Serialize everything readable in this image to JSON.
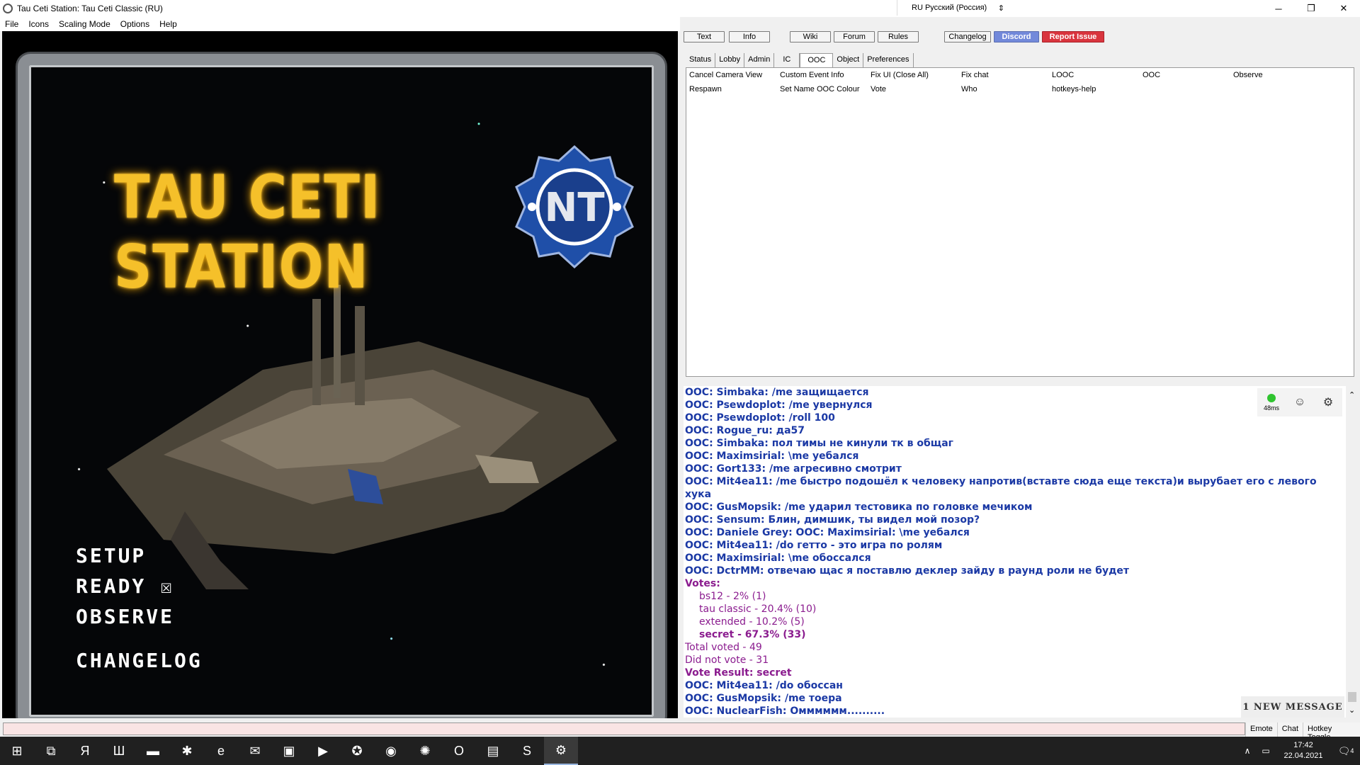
{
  "window": {
    "title": "Tau Ceti Station: Tau Ceti Classic (RU)",
    "language": "RU Русский (Россия)",
    "minimize": "─",
    "maximize": "❐",
    "close": "✕"
  },
  "menu": [
    "File",
    "Icons",
    "Scaling Mode",
    "Options",
    "Help"
  ],
  "game": {
    "title": "TAU CETI STATION",
    "logo_text": "NT",
    "lobby_items": [
      "SETUP",
      "READY ☒",
      "OBSERVE",
      "CHANGELOG"
    ]
  },
  "top_buttons": [
    "Text",
    "Info",
    "Wiki",
    "Forum",
    "Rules",
    "Changelog",
    "Discord",
    "Report Issue"
  ],
  "tabs": [
    "Status",
    "Lobby",
    "Admin",
    "IC",
    "OOC",
    "Object",
    "Preferences"
  ],
  "active_tab": "OOC",
  "verbs": [
    "Cancel Camera View",
    "Custom Event Info",
    "Fix UI (Close All)",
    "Fix chat",
    "LOOC",
    "OOC",
    "Observe",
    "Respawn",
    "Set Name OOC Colour",
    "Vote",
    "Who",
    "hotkeys-help"
  ],
  "chat_tools": {
    "ping": "48ms",
    "emoji_icon": "smiley-icon",
    "settings_icon": "gear-icon"
  },
  "chat_lines": [
    {
      "t": "OOC: Simbaka: /me защищается",
      "k": "ooc"
    },
    {
      "t": "OOC: Psewdoplot: /me увернулся",
      "k": "ooc"
    },
    {
      "t": "OOC: Psewdoplot: /roll 100",
      "k": "ooc"
    },
    {
      "t": "OOC: Rogue_ru: да57",
      "k": "ooc"
    },
    {
      "t": "OOC: Simbaka: пол тимы не кинули тк в общаг",
      "k": "ooc"
    },
    {
      "t": "OOC: Maximsirial: \\me уебался",
      "k": "ooc"
    },
    {
      "t": "OOC: Gort133: /me агресивно смотрит",
      "k": "ooc"
    },
    {
      "t": "OOC: Mit4ea11: /me быстро подошёл к человеку напротив(вставте сюда еще текста)и вырубает его с левого хука",
      "k": "ooc"
    },
    {
      "t": "OOC: GusMopsik: /me ударил тестовика по головке мечиком",
      "k": "ooc"
    },
    {
      "t": "OOC: Sensum: Блин, димшик, ты видел мой позор?",
      "k": "ooc"
    },
    {
      "t": "OOC: Daniele Grey: OOC: Maximsirial: \\me уебался",
      "k": "ooc"
    },
    {
      "t": "OOC: Mit4ea11: /do гетто - это игра по ролям",
      "k": "ooc"
    },
    {
      "t": "OOC: Maximsirial: \\me обоссался",
      "k": "ooc"
    },
    {
      "t": "OOC: DctrMM: отвечаю щас я поставлю деклер зайду в раунд роли не будет",
      "k": "ooc"
    },
    {
      "t": "Votes:",
      "k": "vote-b"
    },
    {
      "t": "bs12 - 2% (1)",
      "k": "vote-ind"
    },
    {
      "t": "tau classic - 20.4% (10)",
      "k": "vote-ind"
    },
    {
      "t": "extended - 10.2% (5)",
      "k": "vote-ind"
    },
    {
      "t": "secret - 67.3% (33)",
      "k": "vote-ind-b"
    },
    {
      "t": "Total voted - 49",
      "k": "vote"
    },
    {
      "t": "Did not vote - 31",
      "k": "vote"
    },
    {
      "t": "Vote Result: secret",
      "k": "vote-b"
    },
    {
      "t": "OOC: Mit4ea11: /do обоссан",
      "k": "ooc"
    },
    {
      "t": "OOC: GusMopsik: /me тоера",
      "k": "ooc"
    },
    {
      "t": "OOC: NuclearFish: Омммммм..........",
      "k": "ooc"
    }
  ],
  "new_message": "1 NEW MESSAGE",
  "bottom_buttons": [
    "Emote",
    "Chat",
    "Hotkey Toggle"
  ],
  "taskbar": {
    "icons": [
      "windows-start-icon",
      "task-view-icon",
      "yandex-browser-icon",
      "red-app-icon",
      "file-explorer-icon",
      "green-app-icon",
      "edge-icon",
      "mail-icon",
      "store-icon",
      "zoom-icon",
      "discord-like-icon",
      "steam-icon",
      "byond-icon",
      "opera-icon",
      "window-app-icon",
      "skype-icon",
      "dreamseeker-icon"
    ],
    "time": "17:42",
    "date": "22.04.2021",
    "notif_count": "4"
  }
}
